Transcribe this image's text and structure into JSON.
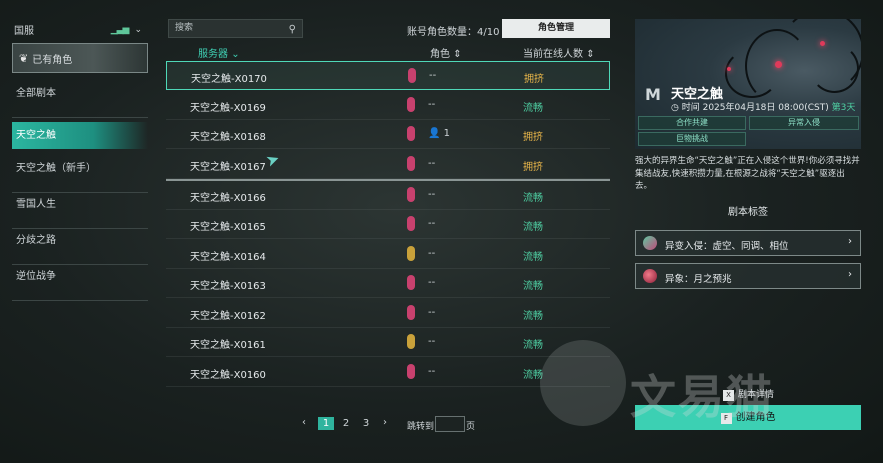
{
  "sidebar": {
    "region": "国服",
    "owned_role": "已有角色",
    "items": [
      {
        "label": "全部剧本"
      },
      {
        "label": "天空之触"
      },
      {
        "label": "天空之触（新手）"
      },
      {
        "label": "雪国人生"
      },
      {
        "label": "分歧之路"
      },
      {
        "label": "逆位战争"
      }
    ],
    "active_index": 1
  },
  "toolbar": {
    "search_placeholder": "搜索",
    "account_count": "账号角色数量：4/10",
    "manage_label": "角色管理"
  },
  "table": {
    "headers": {
      "server": "服务器",
      "role": "角色",
      "online": "当前在线人数"
    },
    "rows": [
      {
        "name": "天空之触-X0170",
        "gem": "pink",
        "role": "--",
        "status": "拥挤"
      },
      {
        "name": "天空之触-X0169",
        "gem": "pink",
        "role": "--",
        "status": "流畅"
      },
      {
        "name": "天空之触-X0168",
        "gem": "pink",
        "role": "1",
        "status": "拥挤"
      },
      {
        "name": "天空之触-X0167",
        "gem": "pink",
        "role": "--",
        "status": "拥挤"
      },
      {
        "name": "天空之触-X0166",
        "gem": "pink",
        "role": "--",
        "status": "流畅"
      },
      {
        "name": "天空之触-X0165",
        "gem": "pink",
        "role": "--",
        "status": "流畅"
      },
      {
        "name": "天空之触-X0164",
        "gem": "yellow",
        "role": "--",
        "status": "流畅"
      },
      {
        "name": "天空之触-X0163",
        "gem": "pink",
        "role": "--",
        "status": "流畅"
      },
      {
        "name": "天空之触-X0162",
        "gem": "pink",
        "role": "--",
        "status": "流畅"
      },
      {
        "name": "天空之触-X0161",
        "gem": "yellow",
        "role": "--",
        "status": "流畅"
      },
      {
        "name": "天空之触-X0160",
        "gem": "pink",
        "role": "--",
        "status": "流畅"
      }
    ]
  },
  "pagination": {
    "prev": "‹",
    "pages": [
      "1",
      "2",
      "3"
    ],
    "current": "1",
    "next": "›",
    "jump_label": "跳转到",
    "page_unit": "页"
  },
  "panel": {
    "title": "天空之触",
    "time": "时间 2025年04月18日 08:00(CST)",
    "day": "第3天",
    "tags": [
      "合作共建",
      "异常入侵",
      "巨物挑战"
    ],
    "description": "强大的异界生命“天空之触”正在入侵这个世界!你必须寻找并集结战友,快速积攒力量,在根源之战将“天空之触”驱逐出去。",
    "section_title": "剧本标签",
    "features": [
      {
        "label": "异变入侵：虚空、同调、相位"
      },
      {
        "label": "异象：月之预兆"
      }
    ],
    "details_key": "X",
    "details_label": "剧本详情",
    "create_key": "F",
    "create_label": "创建角色"
  },
  "watermark": "文易猫",
  "colors": {
    "accent": "#3cd0b3",
    "busy": "#e7b54a",
    "smooth": "#4fd1a4",
    "gem_pink": "#c8416e",
    "gem_yellow": "#c9a13a"
  }
}
